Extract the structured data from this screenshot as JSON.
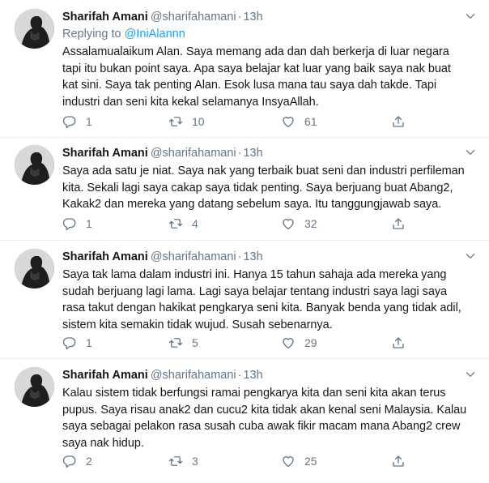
{
  "tweets": [
    {
      "name": "Sharifah Amani",
      "handle": "@sharifahamani",
      "dot": "·",
      "time": "13h",
      "replying_prefix": "Replying to ",
      "replying_to": "@IniAlannn",
      "lines": [
        "Assalamualaikum Alan. Saya memang ada dan dah berkerja di luar negara",
        "tapi itu bukan point saya. Apa saya belajar kat luar yang baik saya nak buat",
        "kat sini. Saya tak penting Alan. Esok lusa mana tau saya dah takde. Tapi",
        "industri dan seni kita kekal selamanya InsyaAllah."
      ],
      "replies": "1",
      "retweets": "10",
      "likes": "61"
    },
    {
      "name": "Sharifah Amani",
      "handle": "@sharifahamani",
      "dot": "·",
      "time": "13h",
      "lines": [
        "Saya ada satu je niat. Saya nak yang terbaik buat seni dan industri perfileman",
        "kita. Sekali lagi saya cakap saya tidak penting. Saya berjuang buat Abang2,",
        "Kakak2 dan mereka yang datang sebelum saya. Itu tanggungjawab saya."
      ],
      "replies": "1",
      "retweets": "4",
      "likes": "32"
    },
    {
      "name": "Sharifah Amani",
      "handle": "@sharifahamani",
      "dot": "·",
      "time": "13h",
      "lines": [
        "Saya tak lama dalam industri ini. Hanya 15 tahun sahaja ada mereka yang",
        "sudah berjuang lagi lama. Lagi saya belajar tentang industri saya lagi saya",
        "rasa takut dengan hakikat pengkarya seni kita. Banyak benda yang tidak adil,",
        "sistem kita semakin tidak wujud. Susah sebenarnya."
      ],
      "replies": "1",
      "retweets": "5",
      "likes": "29"
    },
    {
      "name": "Sharifah Amani",
      "handle": "@sharifahamani",
      "dot": "·",
      "time": "13h",
      "lines": [
        "Kalau sistem tidak berfungsi ramai pengkarya kita dan seni kita akan terus",
        "pupus. Saya risau anak2 dan cucu2 kita tidak akan kenal seni Malaysia. Kalau",
        "saya sebagai pelakon rasa susah cuba awak fikir macam mana Abang2 crew",
        "saya nak hidup."
      ],
      "replies": "2",
      "retweets": "3",
      "likes": "25"
    }
  ],
  "icons": {
    "reply": "reply-icon",
    "retweet": "retweet-icon",
    "like": "like-icon",
    "share": "share-icon",
    "caret": "chevron-down-icon"
  },
  "colors": {
    "text": "#14171a",
    "secondary": "#657786",
    "link": "#1da1f2",
    "divider": "#e6ecf0"
  }
}
